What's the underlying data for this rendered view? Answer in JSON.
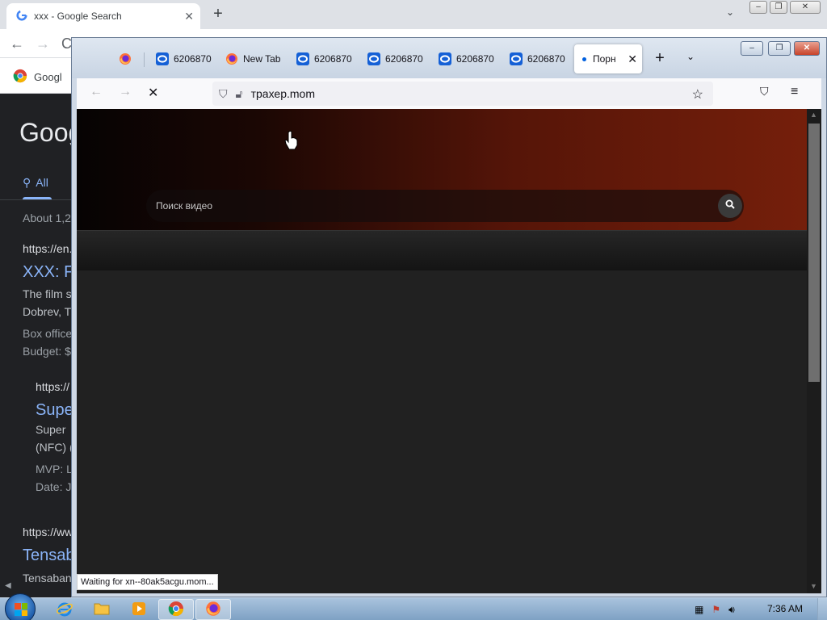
{
  "chrome": {
    "tab_title": "xxx - Google Search",
    "bookmark_label": "Googl",
    "google": {
      "logo_text": "Goog",
      "tab_all": "All",
      "results_count": "About 1,2",
      "results": [
        {
          "cite": "https://en.",
          "title": "XXX: F",
          "lines": [
            "The film s",
            "Dobrev, T"
          ],
          "meta": [
            "Box office",
            "Budget: $"
          ]
        },
        {
          "cite": "https://",
          "title": "Supe",
          "lines": [
            "Super",
            "(NFC) ("
          ],
          "meta": [
            "MVP: L",
            "Date: J"
          ]
        },
        {
          "cite": "https://ww",
          "title": "Tensab",
          "lines": [
            "Tensaban"
          ],
          "meta": []
        }
      ]
    }
  },
  "firefox": {
    "tabs": [
      {
        "type": "firefox",
        "label": ""
      },
      {
        "type": "ring",
        "label": "6206870"
      },
      {
        "type": "firefox",
        "label": "New Tab"
      },
      {
        "type": "ring",
        "label": "6206870"
      },
      {
        "type": "ring",
        "label": "6206870"
      },
      {
        "type": "ring",
        "label": "6206870"
      },
      {
        "type": "ring",
        "label": "6206870"
      }
    ],
    "active_tab_label": "Порн",
    "url": "трахер.mom",
    "search_placeholder": "Поиск видео",
    "status_text": "Waiting for xn--80ak5acgu.mom..."
  },
  "taskbar": {
    "clock": "7:36 AM",
    "apps": [
      "ie",
      "explorer",
      "media-player",
      "chrome",
      "firefox"
    ],
    "active_apps": [
      "chrome",
      "firefox"
    ]
  },
  "colors": {
    "google_link": "#8ab4f8",
    "firefox_accent": "#0060df",
    "header_red": "#751f0b"
  }
}
